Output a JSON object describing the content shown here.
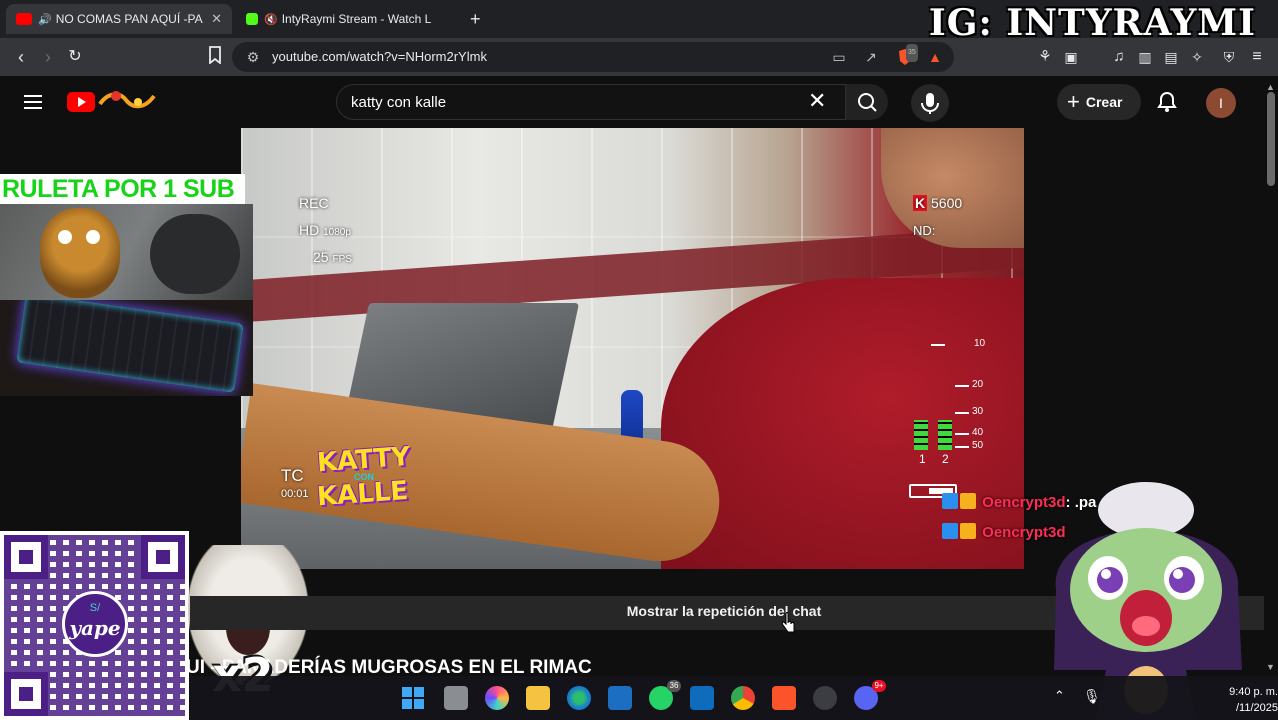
{
  "browser": {
    "tabs": [
      {
        "title": "NO COMAS PAN AQUÍ -PANA",
        "active": true,
        "favicon_color": "#ff0000"
      },
      {
        "title": "IntyRaymi Stream - Watch Live on",
        "active": false,
        "favicon_color": "#53fc18"
      }
    ],
    "new_tab_label": "+",
    "url": "youtube.com/watch?v=NHorm2rYlmk",
    "extension_badge": "35"
  },
  "overlay": {
    "ig_handle": "IG: INTYRAYMI",
    "roulette_text": "RULETA POR 1 SUB",
    "x2_text": "x2",
    "yape_label": "yape",
    "yape_currency": "S/"
  },
  "youtube": {
    "search_query": "katty con kalle",
    "create_label": "Crear",
    "avatar_letter": "I",
    "chat_replay_label": "Mostrar la repetición del chat",
    "video_title": "UI - PANADERÍAS MUGROSAS EN EL RIMAC"
  },
  "player_osd": {
    "rec": "REC",
    "hd": "HD",
    "res": "1080p",
    "fps_value": "25",
    "fps_unit": "FPS",
    "brand": "5600",
    "nd": "ND:",
    "tc": "TC",
    "timecode": "00:01",
    "scale": [
      "10",
      "20",
      "30",
      "40",
      "50"
    ],
    "channels": [
      "1",
      "2"
    ],
    "logo_line1": "KATTY",
    "logo_line2": "CON",
    "logo_line3": "KALLE"
  },
  "chat": [
    {
      "user": "Oencrypt3d",
      "message": ": .pa          cha yada"
    },
    {
      "user": "Oencrypt3d",
      "message": ""
    }
  ],
  "taskbar": {
    "whatsapp_badge": "36",
    "discord_badge": "9+",
    "time": "9:40 p. m.",
    "date": "/11/2025"
  },
  "colors": {
    "yt_red": "#ff0000",
    "accent_green": "#18d318",
    "yape_purple": "#4b1f86",
    "chat_user": "#ff2d55"
  }
}
